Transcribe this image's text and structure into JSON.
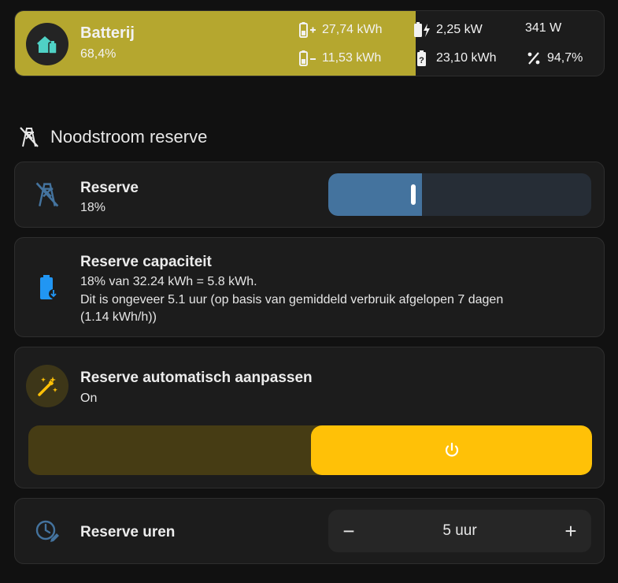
{
  "battery": {
    "title": "Batterij",
    "percent_label": "68,4%",
    "fill_fraction": 0.68,
    "charge_energy": "27,74 kWh",
    "discharge_energy": "11,53 kWh",
    "power": "2,25 kW",
    "remaining": "23,10 kWh",
    "watts": "341 W",
    "efficiency": "94,7%",
    "colors": {
      "fill": "#b5a72f",
      "icon": "#4fd1c5"
    }
  },
  "section": {
    "title": "Noodstroom reserve"
  },
  "reserve": {
    "title": "Reserve",
    "value_label": "18%",
    "value_fraction": 0.355,
    "color": "#44739e"
  },
  "capacity": {
    "title": "Reserve capaciteit",
    "line1": "18% van 32.24 kWh = 5.8 kWh.",
    "line2": "Dit is ongeveer 5.1 uur (op basis van gemiddeld verbruik afgelopen 7 dagen",
    "line3": "(1.14 kWh/h))"
  },
  "auto_adjust": {
    "title": "Reserve automatisch aanpassen",
    "state": "On",
    "color": "#ffc107"
  },
  "hours": {
    "title": "Reserve uren",
    "value": "5 uur",
    "minus": "−",
    "plus": "+"
  }
}
